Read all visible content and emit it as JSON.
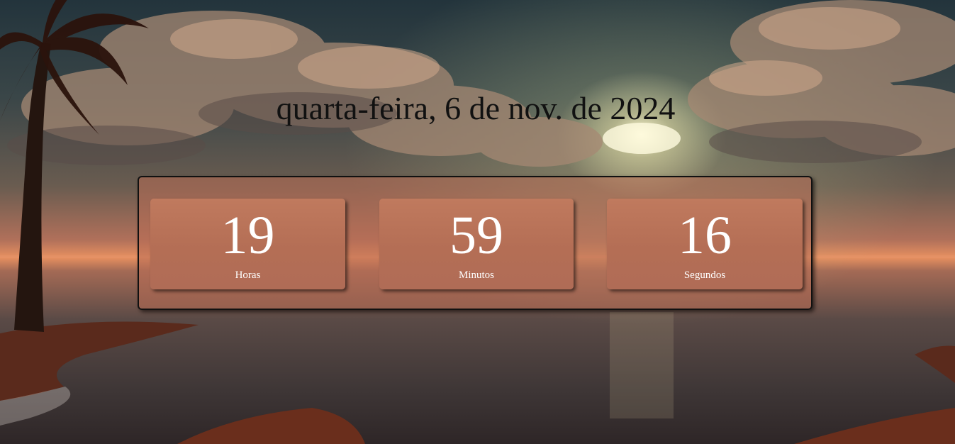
{
  "date_text": "quarta-feira, 6 de nov. de 2024",
  "clock": {
    "hours": {
      "value": "19",
      "label": "Horas"
    },
    "minutes": {
      "value": "59",
      "label": "Minutos"
    },
    "seconds": {
      "value": "16",
      "label": "Segundos"
    }
  },
  "colors": {
    "panel_background": "#b96e55",
    "card_background": "#b8725a",
    "digit_color": "#ffffff",
    "date_color": "#111111"
  },
  "background_image": "sunset-beach-palm"
}
